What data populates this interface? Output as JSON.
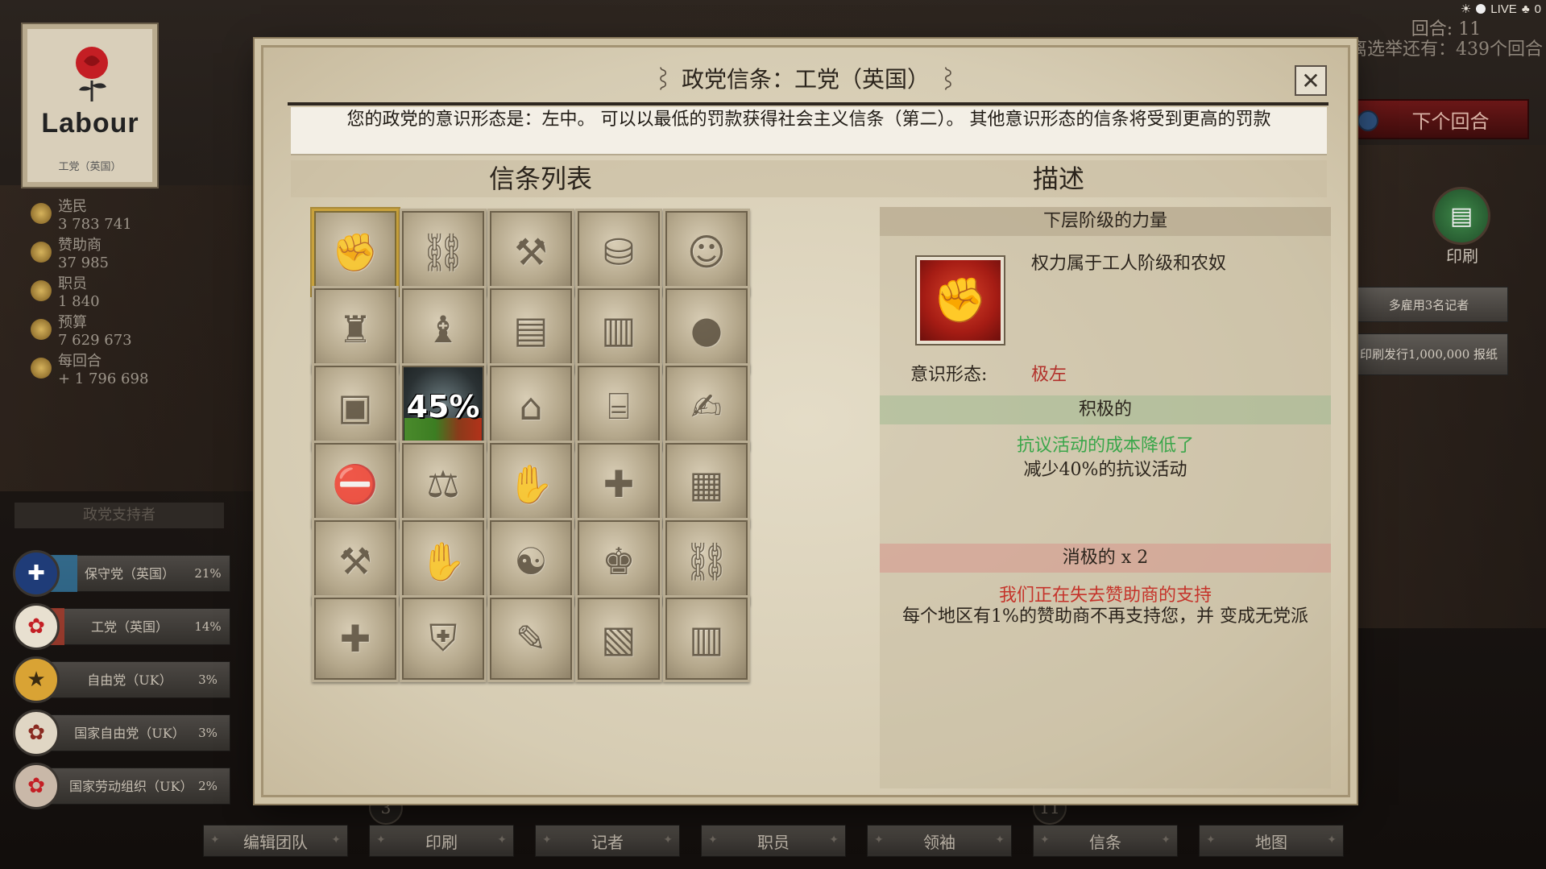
{
  "status": {
    "live_label": "LIVE",
    "viewers": "0"
  },
  "turn": {
    "label": "回合: 11",
    "election_text": "离选举还有：439个回合",
    "next_button": "下个回合"
  },
  "right_panel": {
    "print_label": "印刷",
    "hire_journalists": "多雇用3名记者",
    "print_papers": "印刷发行1,000,000 报纸"
  },
  "party_card": {
    "logo_word": "Labour",
    "name": "工党（英国）"
  },
  "stats": [
    {
      "label": "选民",
      "value": "3 783 741",
      "icon": "voters-icon"
    },
    {
      "label": "赞助商",
      "value": "37 985",
      "icon": "sponsors-icon"
    },
    {
      "label": "职员",
      "value": "1 840",
      "icon": "staff-icon"
    },
    {
      "label": "预算",
      "value": "7 629 673",
      "icon": "budget-icon"
    },
    {
      "label": "每回合",
      "value": "+ 1 796 698",
      "icon": "income-icon"
    }
  ],
  "support": {
    "title": "政党支持者",
    "parties": [
      {
        "name": "保守党（英国）",
        "pct": "21%",
        "share": 0.21,
        "color": "#2f6f95"
      },
      {
        "name": "工党（英国）",
        "pct": "14%",
        "share": 0.14,
        "color": "#a33a2a"
      },
      {
        "name": "自由党（UK）",
        "pct": "3%",
        "share": 0.03,
        "color": "#c98f2a"
      },
      {
        "name": "国家自由党（UK）",
        "pct": "3%",
        "share": 0.03,
        "color": "#c98f2a"
      },
      {
        "name": "国家劳动组织（UK）",
        "pct": "2%",
        "share": 0.02,
        "color": "#a33a2a"
      }
    ]
  },
  "toolbar": {
    "buttons": [
      "编辑团队",
      "印刷",
      "记者",
      "职员",
      "领袖",
      "信条",
      "地图"
    ],
    "badges": [
      "3",
      "11"
    ]
  },
  "dialog": {
    "title": "政党信条：工党（英国）",
    "banner": "您的政党的意识形态是：左中。 可以以最低的罚款获得社会主义信条（第二）。 其他意识形态的信条将受到更高的罚款",
    "list_header": "信条列表",
    "desc_header": "描述",
    "grid_icons": [
      [
        "raised-fist-icon",
        "broken-chain-icon",
        "worker-pickaxes-icon",
        "coin-stacks-icon",
        "leader-portrait-icon"
      ],
      [
        "capitalists-icon",
        "capitalists-handshake-icon",
        "money-bundle-icon",
        "chained-book-icon",
        "hand-globe-icon"
      ],
      [
        "computer-icon",
        "progress-45-icon",
        "house-icon",
        "bank-building-icon",
        "hand-tools-icon"
      ],
      [
        "chained-stop-sign-icon",
        "scales-of-justice-icon",
        "handshake-icon",
        "chained-cross-icon",
        "prison-gate-icon"
      ],
      [
        "hand-hammer-icon",
        "united-hands-icon",
        "religions-icon",
        "tycoon-icon",
        "shackled-neck-icon"
      ],
      [
        "medical-cross-hand-icon",
        "shield-icon",
        "scroll-icon",
        "stop-crate-icon",
        "prison-bars-icon"
      ]
    ],
    "progress_percent": "45%",
    "detail": {
      "heading": "下层阶级的力量",
      "subtitle": "权力属于工人阶级和农奴",
      "ideology_label": "意识形态:",
      "ideology_value": "极左",
      "positive_header": "积极的",
      "positive_title": "抗议活动的成本降低了",
      "positive_text": "减少40%的抗议活动",
      "negative_header": "消极的 x 2",
      "negative_title": "我们正在失去赞助商的支持",
      "negative_text": "每个地区有1%的赞助商不再支持您，并 变成无党派",
      "colors": {
        "positive": "#3aa64a",
        "negative": "#c5332a",
        "ideology": "#b2302a"
      }
    }
  }
}
